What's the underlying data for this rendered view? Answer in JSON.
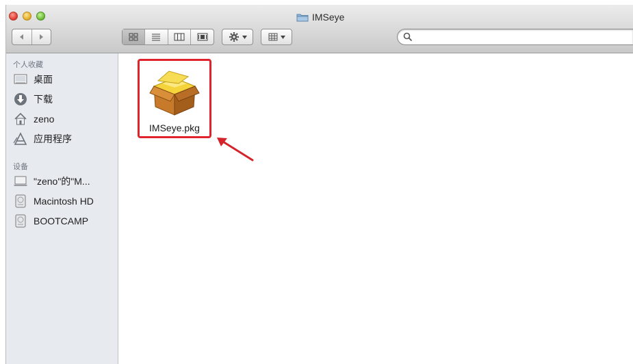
{
  "window": {
    "title": "IMSeye"
  },
  "toolbar": {
    "nav": [
      "back",
      "forward"
    ],
    "view_modes": [
      "icon",
      "list",
      "column",
      "cover-flow"
    ],
    "action": "gear",
    "arrange": "arrange",
    "search": {
      "placeholder": "",
      "value": ""
    }
  },
  "sidebar": {
    "favorites_heading": "个人收藏",
    "favorites": [
      {
        "label": "桌面",
        "icon": "desktop-icon"
      },
      {
        "label": "下载",
        "icon": "downloads-icon"
      },
      {
        "label": "zeno",
        "icon": "home-icon"
      },
      {
        "label": "应用程序",
        "icon": "applications-icon"
      }
    ],
    "devices_heading": "设备",
    "devices": [
      {
        "label": "\"zeno\"的\"M...",
        "icon": "laptop-icon"
      },
      {
        "label": "Macintosh HD",
        "icon": "hard-disk-icon"
      },
      {
        "label": "BOOTCAMP",
        "icon": "hard-disk-icon"
      }
    ]
  },
  "files": [
    {
      "name": "IMSeye.pkg",
      "icon": "package-icon",
      "highlighted": true
    }
  ],
  "colors": {
    "highlight": "#e0222c",
    "sidebar_bg": "#e7ebf0"
  }
}
